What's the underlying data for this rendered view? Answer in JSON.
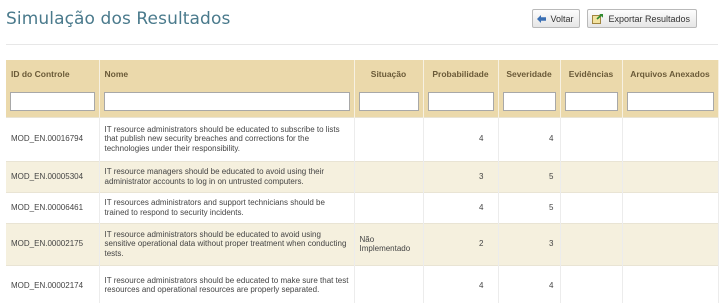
{
  "page": {
    "title": "Simulação dos Resultados"
  },
  "toolbar": {
    "back_label": "Voltar",
    "export_label": "Exportar Resultados"
  },
  "table": {
    "columns": [
      "ID do Controle",
      "Nome",
      "Situação",
      "Probabilidade",
      "Severidade",
      "Evidências",
      "Arquivos Anexados"
    ],
    "filters": [
      "",
      "",
      "",
      "",
      "",
      "",
      ""
    ],
    "rows": [
      {
        "id": "MOD_EN.00016794",
        "nome": "IT resource administrators should be educated to subscribe to lists that publish new security breaches and corrections for the technologies under their responsibility.",
        "situacao": "",
        "probabilidade": "4",
        "severidade": "4",
        "evidencias": "",
        "arquivos": ""
      },
      {
        "id": "MOD_EN.00005304",
        "nome": "IT resource managers should be educated to avoid using their administrator accounts to log in on untrusted computers.",
        "situacao": "",
        "probabilidade": "3",
        "severidade": "5",
        "evidencias": "",
        "arquivos": ""
      },
      {
        "id": "MOD_EN.00006461",
        "nome": "IT resources administrators and support technicians should be trained to respond to security incidents.",
        "situacao": "",
        "probabilidade": "4",
        "severidade": "5",
        "evidencias": "",
        "arquivos": ""
      },
      {
        "id": "MOD_EN.00002175",
        "nome": "IT resource administrators should be educated to avoid using sensitive operational data without proper treatment when conducting tests.",
        "situacao": "Não Implementado",
        "probabilidade": "2",
        "severidade": "3",
        "evidencias": "",
        "arquivos": ""
      },
      {
        "id": "MOD_EN.00002174",
        "nome": "IT resource administrators should be educated to make sure that test resources and operational resources are properly separated.",
        "situacao": "",
        "probabilidade": "4",
        "severidade": "4",
        "evidencias": "",
        "arquivos": ""
      }
    ]
  },
  "colors": {
    "title": "#4a7a8c",
    "header_bg": "#ebd9ab",
    "alt_row": "#f5f0de"
  },
  "icons": {
    "back": "arrow-left-icon",
    "export": "export-icon"
  }
}
